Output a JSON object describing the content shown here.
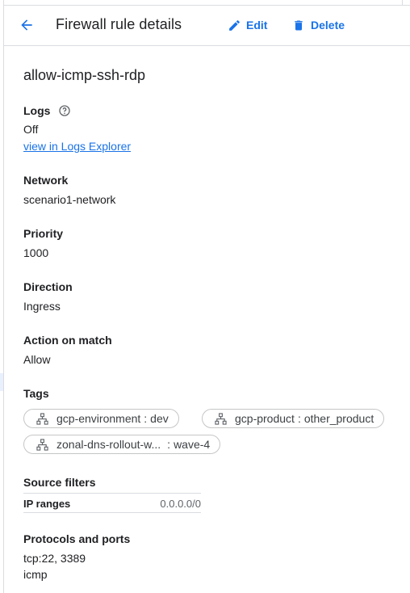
{
  "header": {
    "title": "Firewall rule details",
    "edit_label": "Edit",
    "delete_label": "Delete"
  },
  "rule": {
    "name": "allow-icmp-ssh-rdp",
    "logs": {
      "label": "Logs",
      "value": "Off",
      "link": "view in Logs Explorer"
    },
    "network": {
      "label": "Network",
      "value": "scenario1-network"
    },
    "priority": {
      "label": "Priority",
      "value": "1000"
    },
    "direction": {
      "label": "Direction",
      "value": "Ingress"
    },
    "action": {
      "label": "Action on match",
      "value": "Allow"
    },
    "tags": {
      "label": "Tags",
      "items": [
        {
          "key": "gcp-environment",
          "value": "dev"
        },
        {
          "key": "gcp-product",
          "value": "other_product"
        },
        {
          "key": "zonal-dns-rollout-w...",
          "value": "wave-4"
        }
      ]
    },
    "source_filters": {
      "label": "Source filters",
      "key": "IP ranges",
      "value": "0.0.0.0/0"
    },
    "protocols": {
      "label": "Protocols and ports",
      "lines": [
        "tcp:22, 3389",
        "icmp"
      ]
    }
  },
  "colors": {
    "accent": "#1a73e8",
    "text": "#202124",
    "divider": "#dadce0"
  }
}
